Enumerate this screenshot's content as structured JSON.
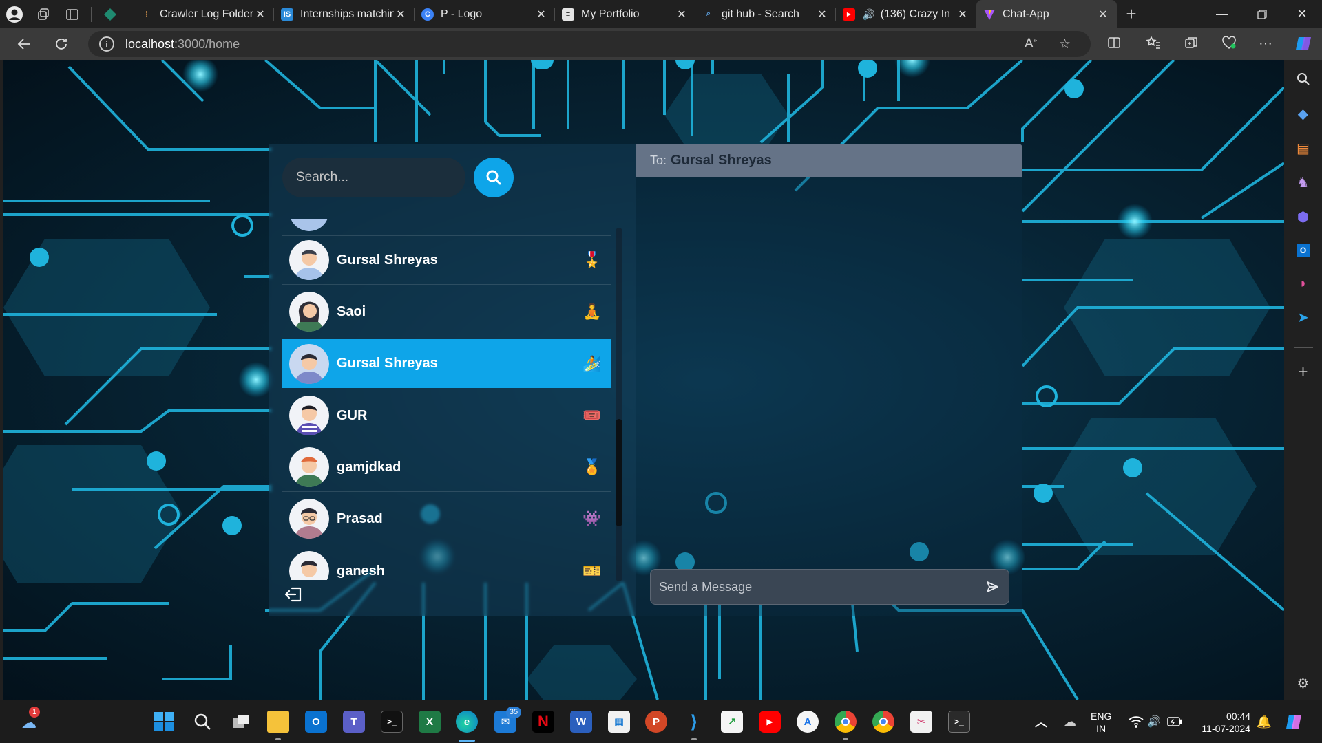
{
  "browser": {
    "tabs": [
      {
        "title": "Crawler Log Folder",
        "favicon": "crawler-favicon",
        "color": "#c58a4a"
      },
      {
        "title": "Internships matching",
        "favicon": "internshala-favicon",
        "color": "#2b8ad8"
      },
      {
        "title": "P - Logo",
        "favicon": "copilot-favicon",
        "color": "#3b82f6"
      },
      {
        "title": "My Portfolio",
        "favicon": "portfolio-favicon",
        "color": "#e5e5e5"
      },
      {
        "title": "git hub - Search",
        "favicon": "search-favicon",
        "color": "#5a9bd8"
      },
      {
        "title": "(136) Crazy In",
        "favicon": "youtube-favicon",
        "color": "#ff0000"
      },
      {
        "title": "Chat-App",
        "favicon": "vite-favicon",
        "color": "#a855f7"
      }
    ],
    "active_tab_index": 6,
    "url_host": "localhost",
    "url_path": ":3000/home"
  },
  "chat": {
    "search_placeholder": "Search...",
    "to_label": "To:",
    "to_name": "Gursal Shreyas",
    "message_placeholder": "Send a Message",
    "accent": "#0ea5e9",
    "conversations": [
      {
        "name": "",
        "emoji": "🎫",
        "avatar": "avatar-partial-top"
      },
      {
        "name": "Gursal Shreyas",
        "emoji": "🎖️",
        "avatar": "avatar-man-blue-shirt"
      },
      {
        "name": "Saoi",
        "emoji": "🧘",
        "avatar": "avatar-woman-green"
      },
      {
        "name": "Gursal Shreyas",
        "emoji": "🏄",
        "avatar": "avatar-man-sweater",
        "selected": true
      },
      {
        "name": "GUR",
        "emoji": "🎟️",
        "avatar": "avatar-man-striped"
      },
      {
        "name": "gamjdkad",
        "emoji": "🏅",
        "avatar": "avatar-man-orange-hair"
      },
      {
        "name": "Prasad",
        "emoji": "👾",
        "avatar": "avatar-man-glasses"
      },
      {
        "name": "ganesh",
        "emoji": "🎫",
        "avatar": "avatar-partial-bottom"
      }
    ]
  },
  "taskbar": {
    "apps": [
      "start",
      "search",
      "task-view",
      "file-explorer",
      "outlook-new",
      "teams",
      "terminal",
      "excel",
      "edge",
      "mail",
      "netflix",
      "word",
      "store",
      "powerpoint",
      "vscode",
      "stock-app",
      "youtube",
      "app-store",
      "chrome",
      "chrome-profile",
      "snipping-tool",
      "terminal-preview"
    ],
    "mail_badge": "35",
    "weather_badge": "1",
    "lang_top": "ENG",
    "lang_bottom": "IN",
    "time": "00:44",
    "date": "11-07-2024"
  }
}
